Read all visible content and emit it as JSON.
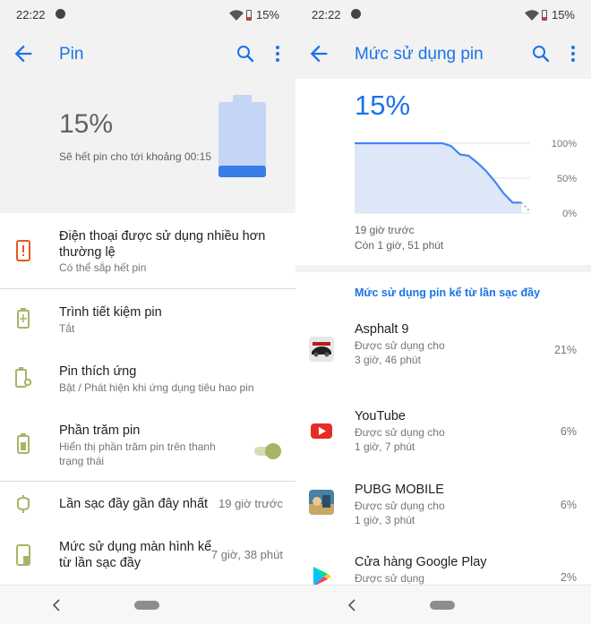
{
  "status": {
    "time": "22:22",
    "battery": "15%"
  },
  "left": {
    "title": "Pin",
    "summary": {
      "percent": "15%",
      "estimate": "Sẽ hết pin cho tới khoảng 00:15",
      "level": 0.15
    },
    "items": [
      {
        "title": "Điện thoại được sử dụng nhiều hơn thường lệ",
        "subtitle": "Có thể sắp hết pin"
      },
      {
        "title": "Trình tiết kiệm pin",
        "subtitle": "Tắt"
      },
      {
        "title": "Pin thích ứng",
        "subtitle": "Bật / Phát hiện khi ứng dụng tiêu hao pin"
      },
      {
        "title": "Phần trăm pin",
        "subtitle": "Hiển thị phần trăm pin trên thanh trạng thái",
        "toggle_on": true
      },
      {
        "title": "Lần sạc đầy gần đây nhất",
        "value": "19 giờ trước"
      },
      {
        "title": "Mức sử dụng màn hình kể từ lần sạc đầy",
        "value": "7 giờ, 38 phút"
      }
    ]
  },
  "right": {
    "title": "Mức sử dụng pin",
    "percent": "15%",
    "chart_labels": {
      "since": "19 giờ trước",
      "remaining": "Còn 1 giờ, 51 phút"
    },
    "section_header": "Mức sử dụng pin kể từ lần sạc đầy",
    "apps": [
      {
        "name": "Asphalt 9",
        "desc": "Được sử dụng cho 3 giờ, 46 phút",
        "pct": "21%"
      },
      {
        "name": "YouTube",
        "desc": "Được sử dụng cho 1 giờ, 7 phút",
        "pct": "6%"
      },
      {
        "name": "PUBG MOBILE",
        "desc": "Được sử dụng cho 1 giờ, 3 phút",
        "pct": "6%"
      },
      {
        "name": "Cửa hàng Google Play",
        "desc": "Được sử dụng",
        "pct": "2%"
      }
    ]
  },
  "chart_data": {
    "type": "area",
    "title": "",
    "xlabel": "",
    "ylabel": "",
    "ytick_labels": [
      "100%",
      "50%",
      "0%"
    ],
    "ylim": [
      0,
      100
    ],
    "x": [
      0,
      0.1,
      0.2,
      0.3,
      0.4,
      0.45,
      0.5,
      0.55,
      0.6,
      0.65,
      0.7,
      0.75,
      0.8,
      0.85,
      0.9,
      0.95
    ],
    "series": [
      {
        "values": [
          100,
          100,
          100,
          100,
          100,
          100,
          100,
          96,
          84,
          82,
          72,
          60,
          45,
          28,
          15,
          15
        ]
      }
    ],
    "projection": {
      "x": [
        0.95,
        1.0
      ],
      "values": [
        15,
        2
      ]
    },
    "colors": {
      "line": "#4285f4",
      "fill": "#dde7f8",
      "projection": "#b0b0b0"
    }
  }
}
